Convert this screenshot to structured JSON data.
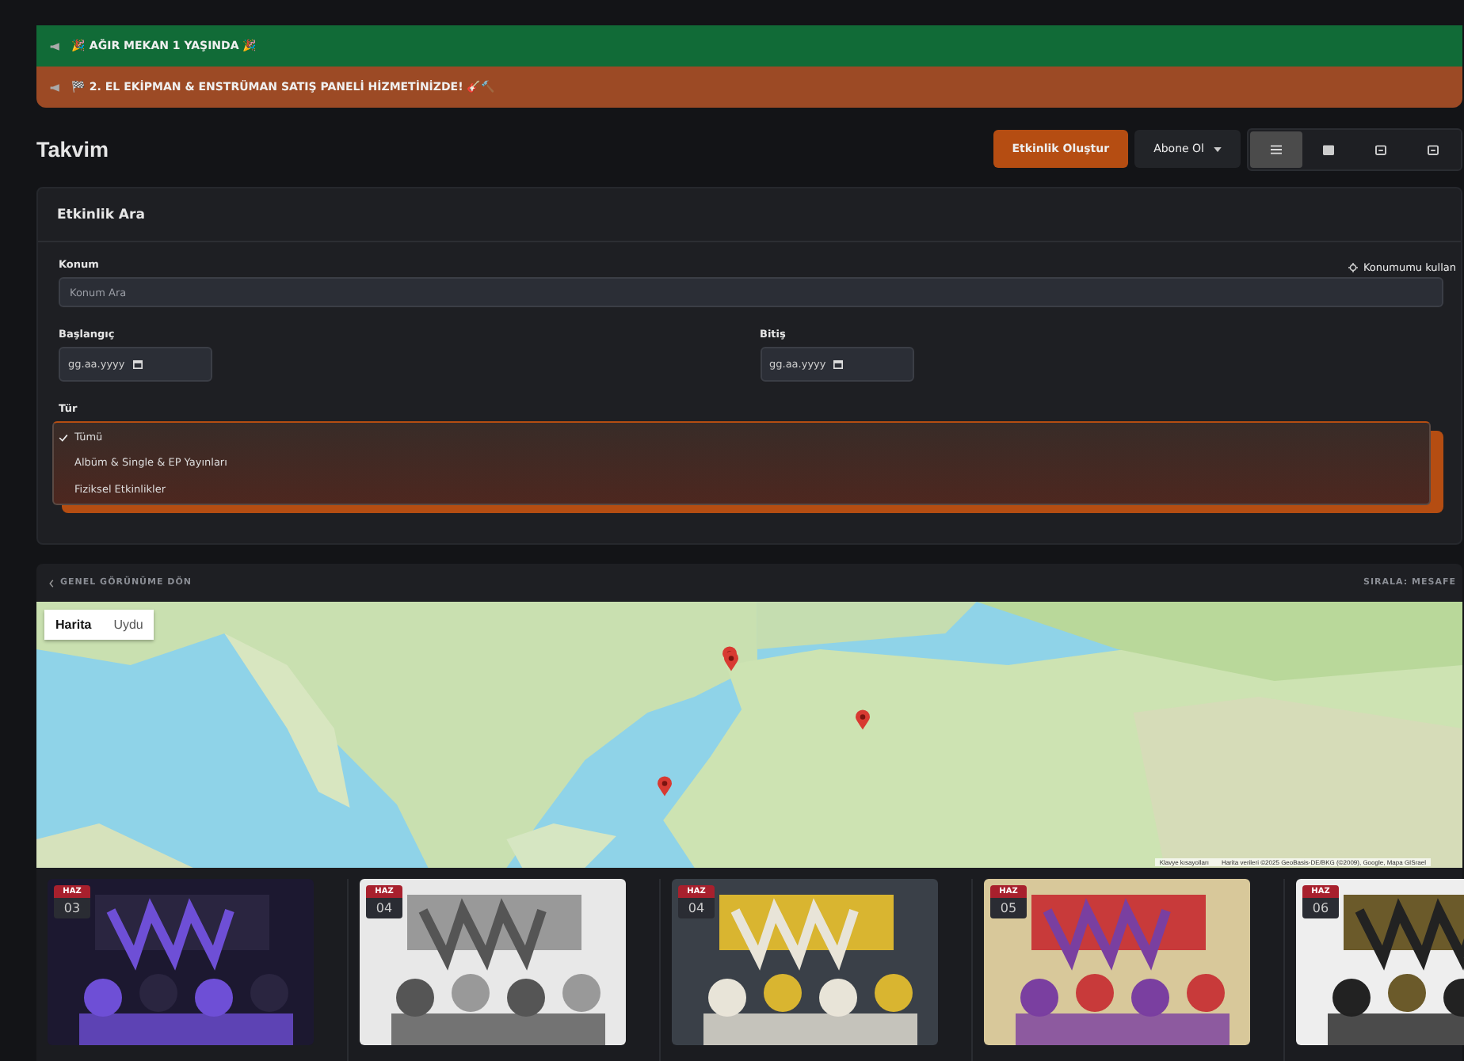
{
  "banners": [
    {
      "kind": "green",
      "text": "🎉 AĞIR MEKAN 1 YAŞINDA 🎉"
    },
    {
      "kind": "orange",
      "text": "🏁 2. EL EKİPMAN & ENSTRÜMAN SATIŞ PANELİ HİZMETİNİZDE! 🎸🔨"
    }
  ],
  "page": {
    "title": "Takvim"
  },
  "toolbar": {
    "create_button": "Etkinlik Oluştur",
    "subscribe_button": "Abone Ol",
    "views": [
      {
        "kind": "list",
        "selected": true
      },
      {
        "kind": "month",
        "selected": false
      },
      {
        "kind": "week",
        "selected": false
      },
      {
        "kind": "day",
        "selected": false
      }
    ]
  },
  "search": {
    "title": "Etkinlik Ara",
    "location_label": "Konum",
    "use_location": "Konumumu kullan",
    "location_placeholder": "Konum Ara",
    "start_label": "Başlangıç",
    "start_placeholder": "gg.aa.yyyy",
    "end_label": "Bitiş",
    "end_placeholder": "gg.aa.yyyy",
    "type_label": "Tür",
    "type_options": [
      {
        "label": "Tümü",
        "selected": true
      },
      {
        "label": "Albüm & Single & EP Yayınları",
        "selected": false
      },
      {
        "label": "Fiziksel Etkinlikler",
        "selected": false
      }
    ]
  },
  "map_section": {
    "back_link": "GENEL GÖRÜNÜME DÖN",
    "sort": "SIRALA: MESAFE",
    "map_types": [
      {
        "label": "Harita",
        "selected": true
      },
      {
        "label": "Uydu",
        "selected": false
      }
    ],
    "shortcuts": "Klavye kısayolları",
    "attribution": "Harita verileri ©2025 GeoBasis-DE/BKG (©2009), Google, Mapa GISrael"
  },
  "events": [
    {
      "month": "HAZ",
      "day": "03"
    },
    {
      "month": "HAZ",
      "day": "04"
    },
    {
      "month": "HAZ",
      "day": "04"
    },
    {
      "month": "HAZ",
      "day": "05"
    },
    {
      "month": "HAZ",
      "day": "06"
    }
  ]
}
